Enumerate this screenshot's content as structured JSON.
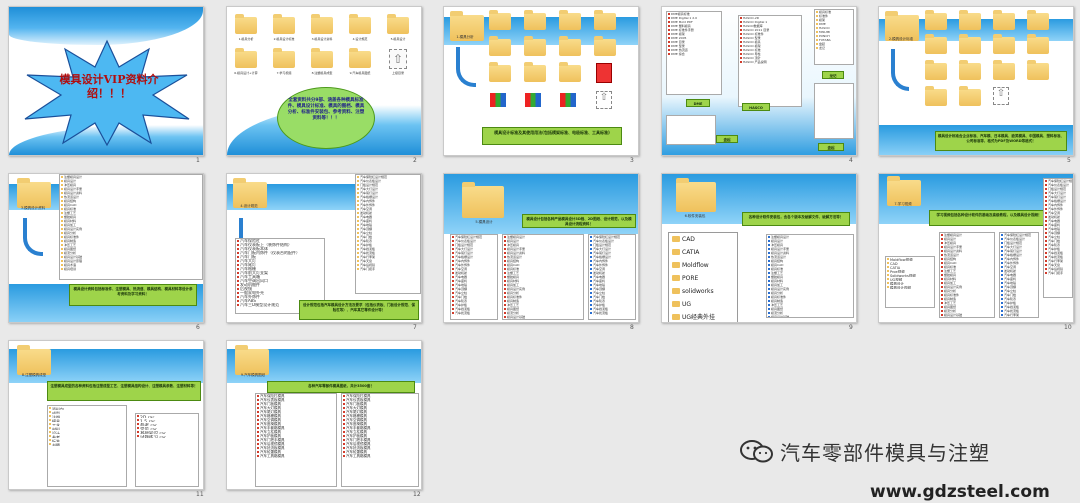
{
  "slides": [
    {
      "num": "1",
      "title": "模具设计VIP资料介绍！！！"
    },
    {
      "num": "2",
      "folders": [
        "1.模具分析",
        "2.模具设计标准",
        "3.模具设计资料",
        "4.设计规范",
        "5.模具设计",
        "6.模具设计+计算",
        "7.学习视频",
        "8.注塑模具成型",
        "9.汽车模具图纸"
      ],
      "extra_label": "上级目录",
      "bubble": "全套资料共分9部、涵盖各种模具标准件、模具设计标准、模具的图档、模具分析、标准件安装包、参考资料、注塑资料等！！！"
    },
    {
      "num": "3",
      "folder_label": "1.模具分析",
      "box": "模具设计标准及其使用用法(包括模架标准、电极标准、工具标准)"
    },
    {
      "num": "4",
      "col1": [
        "DME模具标准",
        "DME Digital 1 2.0",
        "DME Mold PDF",
        "DME 塑料模具",
        "DME 标准件手册",
        "DME 模架",
        "DME 2005",
        "DME 目录",
        "DME 型录",
        "DME 热流道",
        "DME 综合"
      ],
      "col2": [
        "HASCO-2D",
        "HASCO Digital 1",
        "HASCO数据库",
        "HASCO 2011 目录",
        "HASCO 标准件",
        "HASCO 型录",
        "HASCO 模具",
        "HASCO 模架",
        "HASCO 标准",
        "HASCO 导柱",
        "HASCO 顶针",
        "HASCO 产品说明"
      ],
      "col3": [
        "模具标准",
        "标准件",
        "模架",
        "DME",
        "HASCO",
        "MISUMI",
        "PUNCH",
        "FUTABA",
        "盘起",
        "龙记"
      ],
      "box_a": "DME",
      "box_b": "HASCO",
      "box_c": "盘起",
      "box_d": "龙记"
    },
    {
      "num": "5",
      "folder_label": "2.模具设计标准",
      "box": "模具设计标准含企业标准、汽车模、日本模具、欧美模具、中国模具、塑料标准、公司标准等，格式为PDF及WORD等格式！"
    },
    {
      "num": "6",
      "folder_label": "3.模具设计资料",
      "rows": [
        "注塑模具设计",
        "模具设计",
        "冲压模具",
        "模具设计手册",
        "模具设计资料",
        "热流道设计",
        "模具结构",
        "模具CAD",
        "模具标准",
        "注塑工艺",
        "塑胶模具",
        "模具材料",
        "模具加工",
        "模具设计实例",
        "模具分析",
        "模具标准件",
        "模具制造",
        "冲压工艺",
        "模具图纸",
        "模流分析",
        "模具设计基础",
        "模具设计原理",
        "模具术语",
        "模具培训"
      ],
      "box": "模具设计资料包括标准件、注塑模具、热流道、模具结构、模具材料等设计参考资料及学习资料！"
    },
    {
      "num": "7",
      "folder_label": "4.设计规范",
      "rows": [
        "汽车保险杠",
        "汽车仪表板上（装饰件结构）",
        "汽车仪表板本体",
        "汽车门板内饰件（仪表台的配件）",
        "汽车门板",
        "汽车大灯",
        "汽车尾灯",
        "汽车格栅",
        "汽车前大灯支架",
        "汽车工具箱",
        "汽车空调出风口",
        "发动机舱件",
        "后视镜",
        "一般家电外壳",
        "汽车外饰件",
        "汽车ABS",
        "汽车三D模型设计规范"
      ],
      "right_rows": [
        "汽车保险杠设计规范",
        "汽车仪表板设计",
        "门板设计规范",
        "汽车大灯设计",
        "汽车尾灯设计",
        "汽车格栅设计",
        "汽车内饰件",
        "汽车外饰件",
        "汽车空调",
        "发动机舱",
        "汽车电器",
        "汽车座椅",
        "汽车地毯",
        "汽车顶棚",
        "汽车立柱",
        "汽车门槛",
        "汽车轮罩",
        "汽车护板",
        "汽车挡泥板",
        "汽车扰流板",
        "汽车行李架",
        "汽车天窗",
        "汽车后视镜",
        "汽车门把手"
      ],
      "box": "设计规范包括汽车模具设计方法及要求（包括仪表板、门板设计规范、保险杠等）、汽车其它零件设计等！"
    },
    {
      "num": "8",
      "folder_label": "5.模具设计",
      "box": "模具设计包括各种产品模具设计3D档、2D图纸、设计规范，以及模具设计流程资料！"
    },
    {
      "num": "9",
      "folder_label": "6.软件安装包",
      "softwares": [
        "CAD",
        "CATIA",
        "Moldflow",
        "PORE",
        "solidworks",
        "UG",
        "UG经典外挂"
      ],
      "box": "各种设计软件安装包，含各个版本及破解文件、破解方法等！"
    },
    {
      "num": "10",
      "folder_label": "7.学习视频",
      "list": [
        "Moldflow视频",
        "CAD",
        "CATIA",
        "Proe视频",
        "Solidworks视频",
        "UG视频",
        "模具设计",
        "模具设计视频"
      ],
      "box": "学习视频包括各种设计软件的基础及高级教程，以及模具设计视频！"
    },
    {
      "num": "11",
      "folder_label": "8.注塑模具成型",
      "box": "注塑模具成型的各种资料包括注塑成型工艺、注塑模具结构设计、注塑模具参数、注塑材料等！",
      "left_list": [
        "资料包",
        "成型",
        "注塑",
        "模具",
        "工艺",
        "材料",
        "设计",
        "参考",
        "标准",
        "书籍"
      ],
      "right_list": [
        "2D.rar",
        "1.5.rar",
        "参考.rar",
        "常见.rar",
        "基础知识.rar",
        "试题练习.rar"
      ]
    },
    {
      "num": "12",
      "folder_label": "9.汽车模具图纸",
      "box": "各种汽车零部件模具图纸，共计3500套！",
      "rows": [
        "汽车保险杠模具",
        "汽车仪表板模具",
        "汽车门板模具",
        "汽车大灯模具",
        "汽车尾灯模具",
        "汽车格栅模具",
        "汽车空调模具",
        "汽车座椅模具",
        "汽车手套箱模具",
        "汽车立柱模具",
        "汽车护板模具",
        "汽车门把手模具",
        "汽车后视镜模具",
        "汽车扰流板模具",
        "汽车轮罩模具",
        "汽车工具箱模具"
      ]
    }
  ],
  "watermark": "汽车零部件模具与注塑",
  "site": "www.gdzsteel.com",
  "colors": {
    "accent_blue": "#1f8fd8",
    "green_box": "#9ed44a",
    "title_red": "#b20d0d"
  }
}
